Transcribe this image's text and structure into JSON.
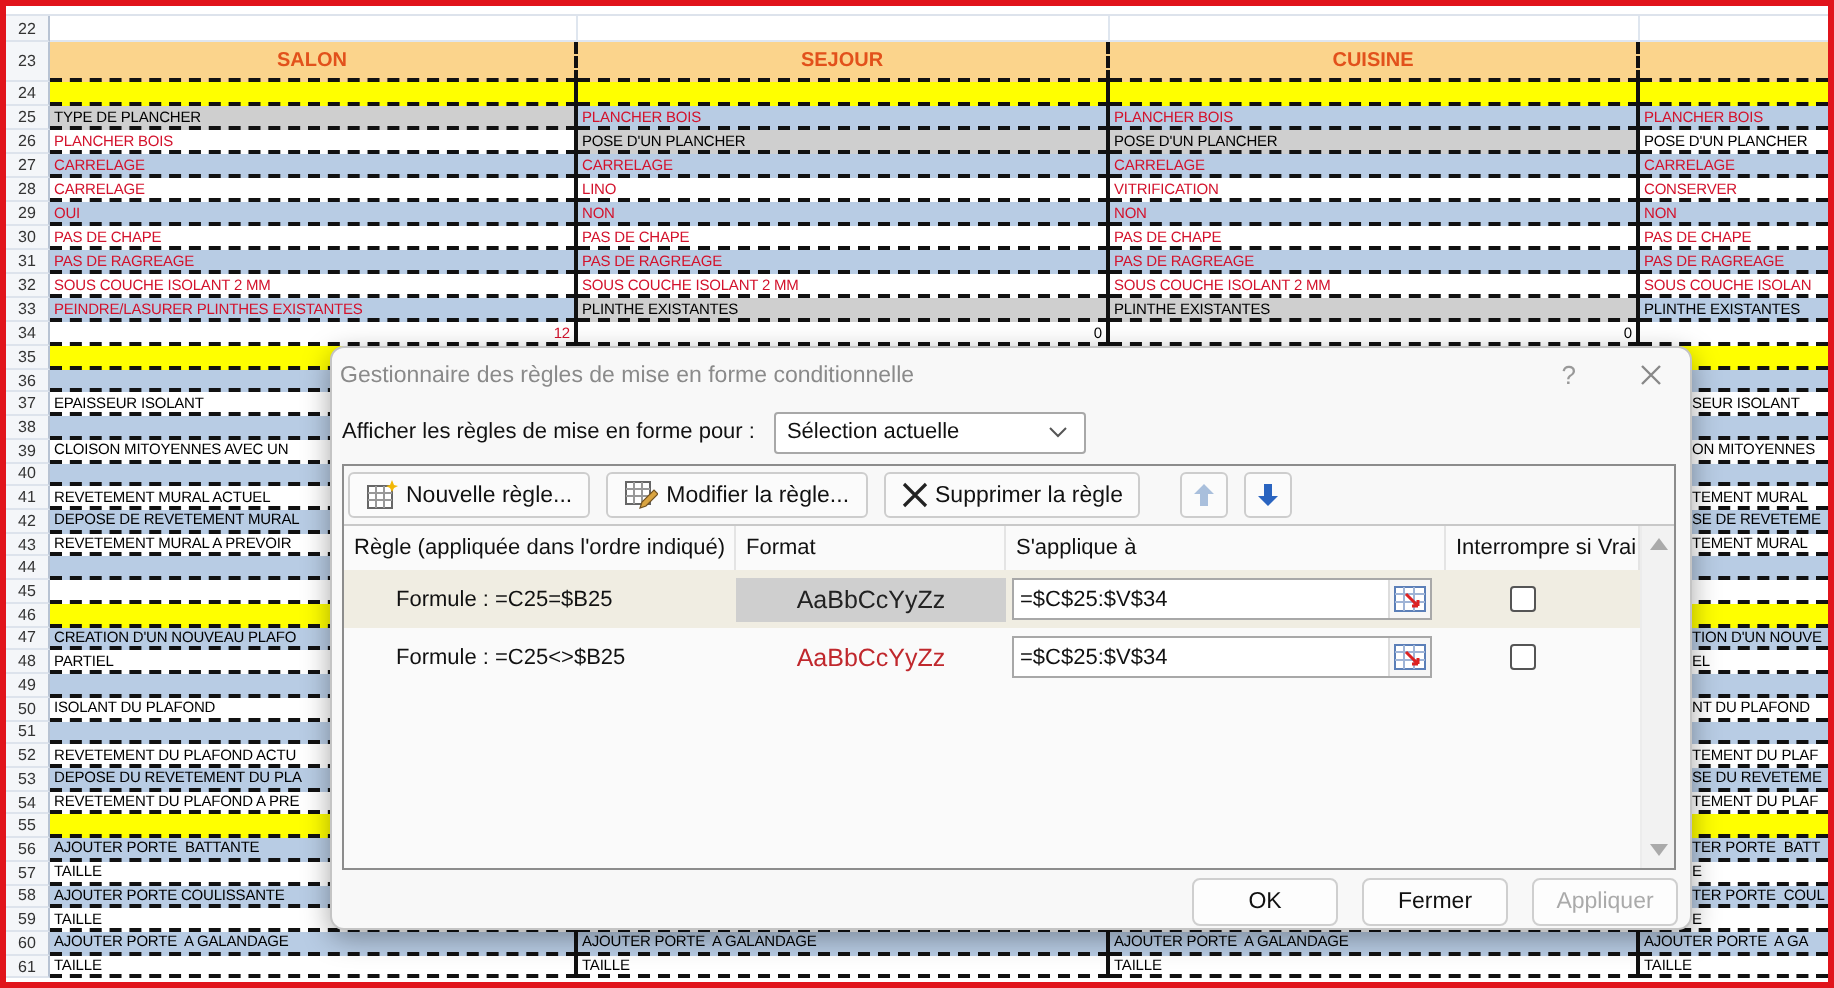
{
  "sheet": {
    "rows": [
      {
        "number": "22",
        "kind": "blank"
      },
      {
        "number": "23",
        "kind": "header",
        "cells": [
          {
            "text": "SALON"
          },
          {
            "text": "SEJOUR"
          },
          {
            "text": "CUISINE"
          },
          null
        ]
      },
      {
        "number": "24",
        "kind": "separator"
      },
      {
        "number": "25",
        "kind": "blue",
        "cells": [
          {
            "text": "TYPE DE PLANCHER",
            "kind": "match"
          },
          {
            "text": "PLANCHER BOIS",
            "kind": "differ"
          },
          {
            "text": "PLANCHER BOIS",
            "kind": "differ"
          },
          {
            "text": "PLANCHER BOIS",
            "kind": "differ"
          }
        ]
      },
      {
        "number": "26",
        "kind": "white",
        "cells": [
          {
            "text": "PLANCHER BOIS",
            "kind": "differ"
          },
          {
            "text": "POSE D'UN PLANCHER",
            "kind": "match"
          },
          {
            "text": "POSE D'UN PLANCHER",
            "kind": "match"
          },
          {
            "text": "POSE D'UN PLANCHER",
            "kind": "plain"
          }
        ]
      },
      {
        "number": "27",
        "kind": "blue",
        "cells": [
          {
            "text": "CARRELAGE",
            "kind": "differ"
          },
          {
            "text": "CARRELAGE",
            "kind": "differ"
          },
          {
            "text": "CARRELAGE",
            "kind": "differ"
          },
          {
            "text": "CARRELAGE",
            "kind": "differ"
          }
        ]
      },
      {
        "number": "28",
        "kind": "white",
        "cells": [
          {
            "text": "CARRELAGE",
            "kind": "differ"
          },
          {
            "text": "LINO",
            "kind": "differ"
          },
          {
            "text": "VITRIFICATION",
            "kind": "differ"
          },
          {
            "text": "CONSERVER",
            "kind": "differ"
          }
        ]
      },
      {
        "number": "29",
        "kind": "blue",
        "cells": [
          {
            "text": "OUI",
            "kind": "differ"
          },
          {
            "text": "NON",
            "kind": "differ"
          },
          {
            "text": "NON",
            "kind": "differ"
          },
          {
            "text": "NON",
            "kind": "differ"
          }
        ]
      },
      {
        "number": "30",
        "kind": "white",
        "cells": [
          {
            "text": "PAS DE CHAPE",
            "kind": "differ"
          },
          {
            "text": "PAS DE CHAPE",
            "kind": "differ"
          },
          {
            "text": "PAS DE CHAPE",
            "kind": "differ"
          },
          {
            "text": "PAS DE CHAPE",
            "kind": "differ"
          }
        ]
      },
      {
        "number": "31",
        "kind": "blue",
        "cells": [
          {
            "text": "PAS DE RAGREAGE",
            "kind": "differ"
          },
          {
            "text": "PAS DE RAGREAGE",
            "kind": "differ"
          },
          {
            "text": "PAS DE RAGREAGE",
            "kind": "differ"
          },
          {
            "text": "PAS DE RAGREAGE",
            "kind": "differ"
          }
        ]
      },
      {
        "number": "32",
        "kind": "white",
        "cells": [
          {
            "text": "SOUS COUCHE ISOLANT 2 MM",
            "kind": "differ"
          },
          {
            "text": "SOUS COUCHE ISOLANT 2 MM",
            "kind": "differ"
          },
          {
            "text": "SOUS COUCHE ISOLANT 2 MM",
            "kind": "differ"
          },
          {
            "text": "SOUS COUCHE ISOLAN",
            "kind": "differ"
          }
        ]
      },
      {
        "number": "33",
        "kind": "blue",
        "cells": [
          {
            "text": "PEINDRE/LASURER PLINTHES EXISTANTES",
            "kind": "differ"
          },
          {
            "text": "PLINTHE EXISTANTES",
            "kind": "match"
          },
          {
            "text": "PLINTHE EXISTANTES",
            "kind": "match"
          },
          {
            "text": "PLINTHE EXISTANTES",
            "kind": "plain"
          }
        ]
      },
      {
        "number": "34",
        "kind": "total",
        "cells": [
          {
            "text": "12",
            "kind": "differ"
          },
          {
            "text": "0",
            "kind": "plain"
          },
          {
            "text": "0",
            "kind": "plain"
          },
          null
        ]
      },
      {
        "number": "35",
        "kind": "separator"
      },
      {
        "number": "36",
        "kind": "blue"
      },
      {
        "number": "37",
        "kind": "white",
        "cells": [
          {
            "text": "EPAISSEUR ISOLANT",
            "kind": "plain"
          },
          null,
          null,
          {
            "text": "SEUR ISOLANT",
            "kind": "plain"
          }
        ]
      },
      {
        "number": "38",
        "kind": "blue"
      },
      {
        "number": "39",
        "kind": "white",
        "cells": [
          {
            "text": "CLOISON MITOYENNES AVEC UN",
            "kind": "plain"
          },
          null,
          null,
          {
            "text": "ON MITOYENNES",
            "kind": "plain"
          }
        ]
      },
      {
        "number": "40",
        "kind": "blue"
      },
      {
        "number": "41",
        "kind": "white",
        "cells": [
          {
            "text": "REVETEMENT MURAL ACTUEL",
            "kind": "plain"
          },
          null,
          null,
          {
            "text": "TEMENT MURAL",
            "kind": "plain"
          }
        ]
      },
      {
        "number": "42",
        "kind": "blue",
        "cells": [
          {
            "text": "DEPOSE DE REVETEMENT MURAL",
            "kind": "plain"
          },
          null,
          null,
          {
            "text": "SE DE REVETEME",
            "kind": "plain"
          }
        ]
      },
      {
        "number": "43",
        "kind": "white",
        "cells": [
          {
            "text": "REVETEMENT MURAL A PREVOIR",
            "kind": "plain"
          },
          null,
          null,
          {
            "text": "TEMENT MURAL",
            "kind": "plain"
          }
        ]
      },
      {
        "number": "44",
        "kind": "blue"
      },
      {
        "number": "45",
        "kind": "white"
      },
      {
        "number": "46",
        "kind": "separator"
      },
      {
        "number": "47",
        "kind": "blue",
        "cells": [
          {
            "text": "CREATION D'UN NOUVEAU PLAFO",
            "kind": "plain"
          },
          null,
          null,
          {
            "text": "TION D'UN NOUVE",
            "kind": "plain"
          }
        ]
      },
      {
        "number": "48",
        "kind": "white",
        "cells": [
          {
            "text": "PARTIEL",
            "kind": "plain"
          },
          null,
          null,
          {
            "text": "EL",
            "kind": "plain"
          }
        ]
      },
      {
        "number": "49",
        "kind": "blue"
      },
      {
        "number": "50",
        "kind": "white",
        "cells": [
          {
            "text": "ISOLANT DU PLAFOND",
            "kind": "plain"
          },
          null,
          null,
          {
            "text": "NT DU PLAFOND",
            "kind": "plain"
          }
        ]
      },
      {
        "number": "51",
        "kind": "blue"
      },
      {
        "number": "52",
        "kind": "white",
        "cells": [
          {
            "text": "REVETEMENT DU PLAFOND ACTU",
            "kind": "plain"
          },
          null,
          null,
          {
            "text": "TEMENT DU PLAF",
            "kind": "plain"
          }
        ]
      },
      {
        "number": "53",
        "kind": "blue",
        "cells": [
          {
            "text": "DEPOSE DU REVETEMENT DU PLA",
            "kind": "plain"
          },
          null,
          null,
          {
            "text": "SE DU REVETEME",
            "kind": "plain"
          }
        ]
      },
      {
        "number": "54",
        "kind": "white",
        "cells": [
          {
            "text": "REVETEMENT DU PLAFOND A PRE",
            "kind": "plain"
          },
          null,
          null,
          {
            "text": "TEMENT DU PLAF",
            "kind": "plain"
          }
        ]
      },
      {
        "number": "55",
        "kind": "separator"
      },
      {
        "number": "56",
        "kind": "blue",
        "cells": [
          {
            "text": "AJOUTER PORTE  BATTANTE",
            "kind": "plain"
          },
          null,
          null,
          {
            "text": "TER PORTE  BATT",
            "kind": "plain"
          }
        ]
      },
      {
        "number": "57",
        "kind": "white",
        "cells": [
          {
            "text": "TAILLE",
            "kind": "plain"
          },
          null,
          null,
          {
            "text": "E",
            "kind": "plain"
          }
        ]
      },
      {
        "number": "58",
        "kind": "blue",
        "cells": [
          {
            "text": "AJOUTER PORTE COULISSANTE",
            "kind": "plain"
          },
          null,
          null,
          {
            "text": "TER PORTE  COUL",
            "kind": "plain"
          }
        ]
      },
      {
        "number": "59",
        "kind": "white",
        "cells": [
          {
            "text": "TAILLE",
            "kind": "plain"
          },
          null,
          null,
          {
            "text": "E",
            "kind": "plain"
          }
        ]
      },
      {
        "number": "60",
        "kind": "blue",
        "cells": [
          {
            "text": "AJOUTER PORTE  A GALANDAGE",
            "kind": "plain"
          },
          {
            "text": "AJOUTER PORTE  A GALANDAGE",
            "kind": "plain"
          },
          {
            "text": "AJOUTER PORTE  A GALANDAGE",
            "kind": "plain"
          },
          {
            "text": "AJOUTER PORTE  A GA",
            "kind": "plain"
          }
        ]
      },
      {
        "number": "61",
        "kind": "white",
        "cells": [
          {
            "text": "TAILLE",
            "kind": "plain"
          },
          {
            "text": "TAILLE",
            "kind": "plain"
          },
          {
            "text": "TAILLE",
            "kind": "plain"
          },
          {
            "text": "TAILLE",
            "kind": "plain"
          }
        ]
      }
    ]
  },
  "dialog": {
    "title": "Gestionnaire des règles de mise en forme conditionnelle",
    "help": "?",
    "scope_label": "Afficher les règles de mise en forme pour :",
    "scope_value": "Sélection actuelle",
    "toolbar": [
      {
        "kind": "new",
        "label": "Nouvelle règle...",
        "disabled": false
      },
      {
        "kind": "edit",
        "label": "Modifier la règle...",
        "disabled": false
      },
      {
        "kind": "delete",
        "label": "Supprimer la règle",
        "disabled": false
      },
      {
        "kind": "up",
        "disabled": true
      },
      {
        "kind": "down",
        "disabled": false
      }
    ],
    "columns": [
      "Règle (appliquée dans l'ordre indiqué)",
      "Format",
      "S'applique à",
      "Interrompre si Vrai"
    ],
    "rules": [
      {
        "formula": "Formule : =C25=$B25",
        "preview": "AaBbCcYyZz",
        "kind": "match",
        "applies_to": "=$C$25:$V$34",
        "stop_if_true": false,
        "selected": true
      },
      {
        "formula": "Formule : =C25<>$B25",
        "preview": "AaBbCcYyZz",
        "kind": "differ",
        "applies_to": "=$C$25:$V$34",
        "stop_if_true": false,
        "selected": false
      }
    ],
    "buttons": [
      {
        "label": "OK",
        "disabled": false
      },
      {
        "label": "Fermer",
        "disabled": false
      },
      {
        "label": "Appliquer",
        "disabled": true
      }
    ]
  }
}
